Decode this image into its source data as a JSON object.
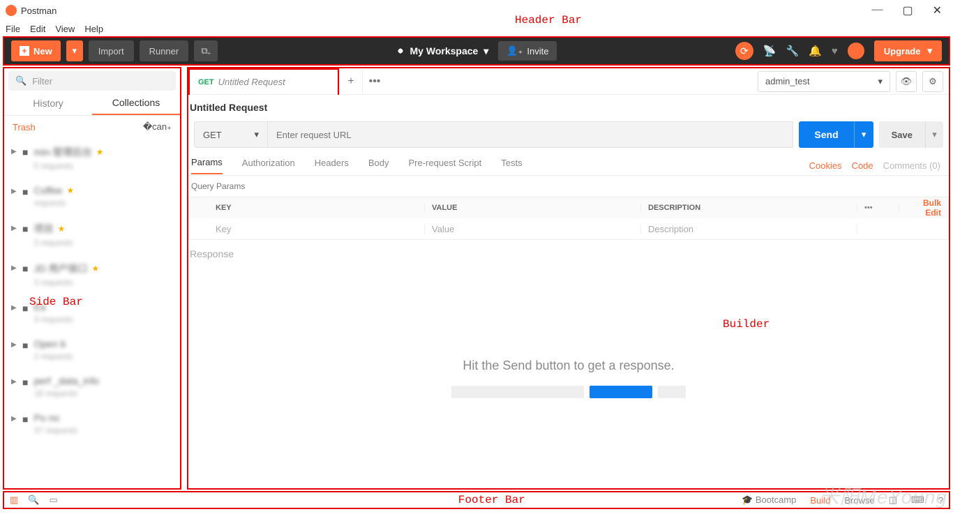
{
  "window": {
    "title": "Postman"
  },
  "menu": {
    "file": "File",
    "edit": "Edit",
    "view": "View",
    "help": "Help"
  },
  "header": {
    "new": "New",
    "import": "Import",
    "runner": "Runner",
    "workspace": "My Workspace",
    "invite": "Invite",
    "upgrade": "Upgrade"
  },
  "annotations": {
    "header": "Header Bar",
    "sidebar": "Side Bar",
    "builder": "Builder",
    "footer": "Footer Bar"
  },
  "sidebar": {
    "filter_placeholder": "Filter",
    "tabs": {
      "history": "History",
      "collections": "Collections"
    },
    "trash": "Trash",
    "items": [
      {
        "name": "min-管理后台",
        "sub": "5 requests",
        "fav": true
      },
      {
        "name": "Coffee",
        "sub": "requests",
        "fav": true
      },
      {
        "name": "项目",
        "sub": "3 requests",
        "fav": true
      },
      {
        "name": "JD 用户接口",
        "sub": "3 requests",
        "fav": true
      },
      {
        "name": "Ea",
        "sub": "3 requests",
        "fav": false
      },
      {
        "name": "Open b",
        "sub": "2 requests",
        "fav": false
      },
      {
        "name": "perf _data_info",
        "sub": "18 requests",
        "fav": false
      },
      {
        "name": "Po no",
        "sub": "37 requests",
        "fav": false
      }
    ]
  },
  "builder": {
    "tab": {
      "method": "GET",
      "name": "Untitled Request"
    },
    "env": "admin_test",
    "title": "Untitled Request",
    "method": "GET",
    "url_placeholder": "Enter request URL",
    "send": "Send",
    "save": "Save",
    "tabs": {
      "params": "Params",
      "auth": "Authorization",
      "headers": "Headers",
      "body": "Body",
      "prereq": "Pre-request Script",
      "tests": "Tests"
    },
    "links": {
      "cookies": "Cookies",
      "code": "Code",
      "comments": "Comments (0)"
    },
    "query_title": "Query Params",
    "th": {
      "key": "KEY",
      "value": "VALUE",
      "desc": "DESCRIPTION",
      "bulk": "Bulk Edit"
    },
    "ph": {
      "key": "Key",
      "value": "Value",
      "desc": "Description"
    },
    "response_label": "Response",
    "response_msg": "Hit the Send button to get a response."
  },
  "footer": {
    "bootcamp": "Bootcamp",
    "build": "Build",
    "browse": "Browse"
  },
  "watermark": "米阳MeYoung"
}
